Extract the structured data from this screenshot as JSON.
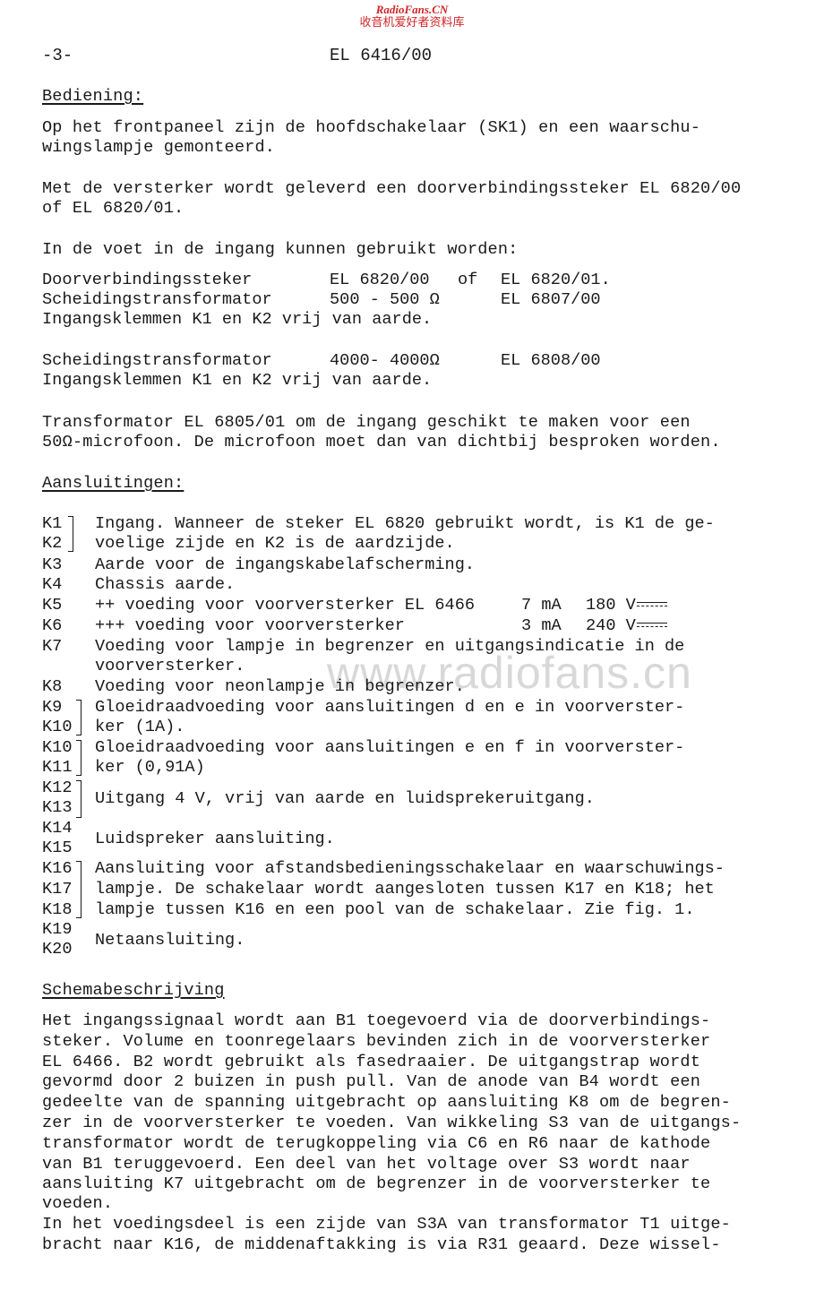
{
  "watermark": {
    "brand": "RadioFans.CN",
    "chinese": "收音机爱好者资料库",
    "center": "www.radiofans.cn",
    "brand_color": "#d0262a"
  },
  "header": {
    "page_number": "-3-",
    "doc_code": "EL 6416/00"
  },
  "bediening": {
    "heading": "Bediening:",
    "para1": [
      "Op het frontpaneel zijn de hoofdschakelaar (SK1) en een waarschu-",
      "wingslampje gemonteerd."
    ],
    "para2": [
      "Met de versterker wordt geleverd een doorverbindingssteker EL 6820/00",
      "of EL 6820/01."
    ],
    "para3": "In de voet in de ingang kunnen gebruikt worden:",
    "options": [
      {
        "name": "Doorverbindingssteker",
        "value": "EL 6820/00",
        "extra": "of",
        "type": "EL 6820/01."
      },
      {
        "name": "Scheidingstransformator",
        "value": "500 - 500 Ω",
        "extra": "",
        "type": "EL 6807/00"
      },
      {
        "note": "Ingangsklemmen K1 en K2 vrij van aarde."
      },
      {
        "name": "Scheidingstransformator",
        "value": "4000- 4000Ω",
        "extra": "",
        "type": "EL 6808/00"
      },
      {
        "note": "Ingangsklemmen K1 en K2 vrij van aarde."
      }
    ],
    "para4": [
      "Transformator EL 6805/01 om de ingang geschikt te maken voor een",
      "50Ω-microfoon. De microfoon moet dan van dichtbij besproken worden."
    ]
  },
  "aansluitingen": {
    "heading": "Aansluitingen:",
    "items": [
      {
        "keys": [
          "K1",
          "K2"
        ],
        "lines": [
          "Ingang. Wanneer de steker EL 6820 gebruikt wordt, is K1 de ge-",
          "voelige zijde en K2 is de aardzijde."
        ]
      },
      {
        "keys": [
          "K3"
        ],
        "lines": [
          "Aarde voor de ingangskabelafscherming."
        ]
      },
      {
        "keys": [
          "K4"
        ],
        "lines": [
          "Chassis aarde."
        ]
      },
      {
        "keys": [
          "K5"
        ],
        "lines": [
          "++ voeding voor voorversterker EL 6466"
        ],
        "current": "7 mA",
        "voltage": "180 V",
        "symbol": "dc"
      },
      {
        "keys": [
          "K6"
        ],
        "lines": [
          "+++ voeding voor voorversterker"
        ],
        "current": "3 mA",
        "voltage": "240 V",
        "symbol": "dc"
      },
      {
        "keys": [
          "K7"
        ],
        "lines": [
          "Voeding voor lampje in begrenzer en uitgangsindicatie in de",
          "voorversterker."
        ]
      },
      {
        "keys": [
          "K8"
        ],
        "lines": [
          "Voeding voor neonlampje in begrenzer."
        ]
      },
      {
        "keys": [
          "K9",
          "K10"
        ],
        "lines": [
          "Gloeidraadvoeding voor aansluitingen d en e in voorverster-",
          "ker (1A)."
        ]
      },
      {
        "keys": [
          "K10",
          "K11"
        ],
        "lines": [
          "Gloeidraadvoeding voor aansluitingen e en f in voorverster-",
          "ker (0,91A)"
        ]
      },
      {
        "keys": [
          "K12",
          "K13"
        ],
        "lines": [
          "Uitgang 4 V, vrij van aarde en luidsprekeruitgang."
        ]
      },
      {
        "keys": [
          "K14",
          "K15"
        ],
        "lines": [
          "Luidspreker aansluiting."
        ]
      },
      {
        "keys": [
          "K16",
          "K17",
          "K18"
        ],
        "lines": [
          "Aansluiting voor afstandsbedieningsschakelaar en waarschuwings-",
          "lampje. De schakelaar wordt aangesloten tussen K17 en K18; het",
          "lampje tussen K16 en een pool van de schakelaar. Zie fig. 1."
        ]
      },
      {
        "keys": [
          "K19",
          "K20"
        ],
        "lines": [
          "Netaansluiting."
        ]
      }
    ]
  },
  "schema": {
    "heading": "Schemabeschrijving",
    "lines": [
      "Het ingangssignaal wordt aan B1 toegevoerd via de doorverbindings-",
      "steker. Volume en toonregelaars bevinden zich in de voorversterker",
      "EL 6466. B2 wordt gebruikt als fasedraaier. De uitgangstrap wordt",
      "gevormd door 2 buizen in push pull. Van de anode van B4 wordt een",
      "gedeelte van de spanning uitgebracht op aansluiting K8 om de begren-",
      "zer in de voorversterker te voeden. Van wikkeling S3 van de uitgangs-",
      "transformator wordt de terugkoppeling via C6 en R6 naar de kathode",
      "van B1 teruggevoerd. Een deel van het voltage over S3 wordt naar",
      "aansluiting K7 uitgebracht om de begrenzer in de voorversterker te",
      "voeden.",
      "In het voedingsdeel is een zijde van S3A van transformator T1 uitge-",
      "bracht naar K16, de middenaftakking is via R31 geaard. Deze wissel-"
    ]
  }
}
